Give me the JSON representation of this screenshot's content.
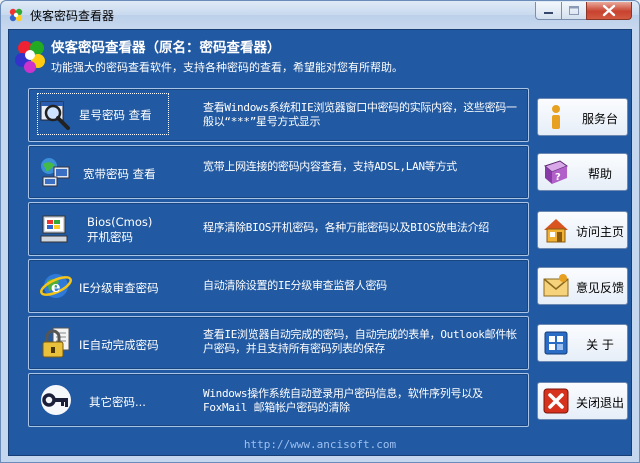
{
  "window": {
    "title": "侠客密码查看器"
  },
  "header": {
    "title": "侠客密码查看器（原名：密码查看器）",
    "subtitle": "功能强大的密码查看软件，支持各种密码的查看，希望能对您有所帮助。"
  },
  "items": [
    {
      "label": "星号密码 查看",
      "desc": "查看Windows系统和IE浏览器窗口中密码的实际内容，这些密码一般以“***”星号方式显示",
      "icon": "magnifier-icon"
    },
    {
      "label": "宽带密码 查看",
      "desc": "宽带上网连接的密码内容查看，支持ADSL,LAN等方式",
      "icon": "network-icon"
    },
    {
      "label": "Bios(Cmos)",
      "label2": "开机密码",
      "desc": "程序清除BIOS开机密码，各种万能密码以及BIOS放电法介绍",
      "icon": "computer-icon"
    },
    {
      "label": "IE分级审查密码",
      "desc": "自动清除设置的IE分级审查监督人密码",
      "icon": "ie-globe-icon"
    },
    {
      "label": "IE自动完成密码",
      "desc": "查看IE浏览器自动完成的密码，自动完成的表单，Outlook邮件帐户密码，并且支持所有密码列表的保存",
      "icon": "lock-icon"
    },
    {
      "label": "其它密码...",
      "desc": "Windows操作系统自动登录用户密码信息，软件序列号以及FoxMail 邮箱帐户密码的清除",
      "icon": "key-icon"
    }
  ],
  "buttons": [
    {
      "label": "服务台",
      "icon": "info-icon"
    },
    {
      "label": "帮助",
      "icon": "help-book-icon"
    },
    {
      "label": "访问主页",
      "icon": "home-icon"
    },
    {
      "label": "意见反馈",
      "icon": "mail-icon"
    },
    {
      "label": "关  于",
      "icon": "about-icon"
    },
    {
      "label": "关闭退出",
      "icon": "close-x-icon"
    }
  ],
  "footer": {
    "url": "http://www.ancisoft.com"
  }
}
